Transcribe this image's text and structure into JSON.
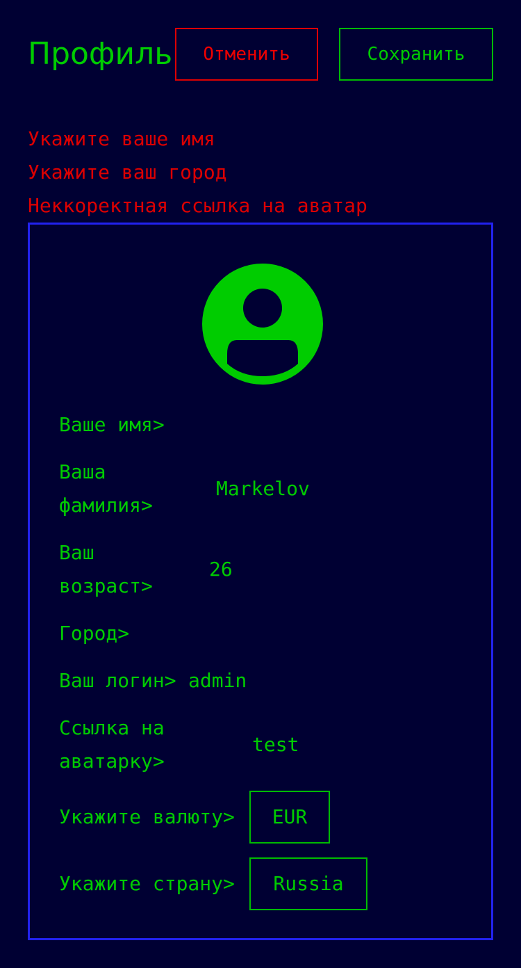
{
  "header": {
    "title": "Профиль",
    "cancel_label": "Отменить",
    "save_label": "Сохранить"
  },
  "errors": [
    "Укажите ваше имя",
    "Укажите ваш город",
    "Неккоректная ссылка на аватар"
  ],
  "avatar": {
    "icon": "user-icon"
  },
  "form": {
    "first_name": {
      "label": "Ваше имя>",
      "value": ""
    },
    "last_name": {
      "label": "Ваша фамилия>",
      "value": "Markelov"
    },
    "age": {
      "label": "Ваш возраст>",
      "value": "26"
    },
    "city": {
      "label": "Город>",
      "value": ""
    },
    "login": {
      "label": "Ваш логин>",
      "value": "admin"
    },
    "avatar_url": {
      "label": "Ссылка на аватарку>",
      "value": "test"
    },
    "currency": {
      "label": "Укажите валюту>",
      "value": "EUR"
    },
    "country": {
      "label": "Укажите страну>",
      "value": "Russia"
    }
  },
  "colors": {
    "background": "#000033",
    "accent": "#00cc00",
    "error": "#dd0000",
    "card_border": "#2222ee"
  }
}
